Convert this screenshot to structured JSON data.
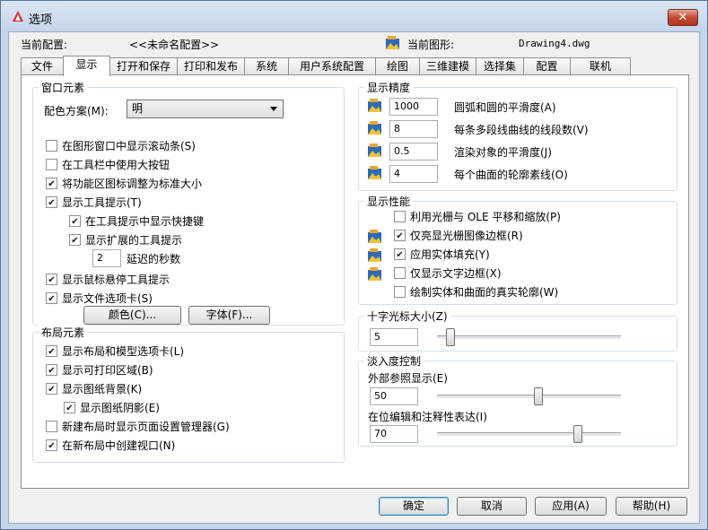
{
  "window": {
    "title": "选项",
    "close_label": "✕"
  },
  "profile": {
    "label": "当前配置:",
    "value": "<<未命名配置>>"
  },
  "drawing": {
    "label": "当前图形:",
    "value": "Drawing4.dwg"
  },
  "tabs": [
    "文件",
    "显示",
    "打开和保存",
    "打印和发布",
    "系统",
    "用户系统配置",
    "绘图",
    "三维建模",
    "选择集",
    "配置",
    "联机"
  ],
  "active_tab": "显示",
  "window_elements": {
    "title": "窗口元素",
    "color_scheme_label": "配色方案(M):",
    "color_scheme_value": "明",
    "items": [
      {
        "label": "在图形窗口中显示滚动条(S)",
        "checked": false
      },
      {
        "label": "在工具栏中使用大按钮",
        "checked": false
      },
      {
        "label": "将功能区图标调整为标准大小",
        "checked": true
      },
      {
        "label": "显示工具提示(T)",
        "checked": true
      },
      {
        "label": "在工具提示中显示快捷键",
        "checked": true
      },
      {
        "label": "显示扩展的工具提示",
        "checked": true
      },
      {
        "label": "显示鼠标悬停工具提示",
        "checked": true
      },
      {
        "label": "显示文件选项卡(S)",
        "checked": true
      }
    ],
    "delay_value": "2",
    "delay_label": "延迟的秒数",
    "colors_button": "颜色(C)...",
    "fonts_button": "字体(F)..."
  },
  "layout_elements": {
    "title": "布局元素",
    "items": [
      {
        "label": "显示布局和模型选项卡(L)",
        "checked": true
      },
      {
        "label": "显示可打印区域(B)",
        "checked": true
      },
      {
        "label": "显示图纸背景(K)",
        "checked": true
      },
      {
        "label": "显示图纸阴影(E)",
        "checked": true
      },
      {
        "label": "新建布局时显示页面设置管理器(G)",
        "checked": false
      },
      {
        "label": "在新布局中创建视口(N)",
        "checked": true
      }
    ]
  },
  "display_resolution": {
    "title": "显示精度",
    "items": [
      {
        "value": "1000",
        "label": "圆弧和圆的平滑度(A)"
      },
      {
        "value": "8",
        "label": "每条多段线曲线的线段数(V)"
      },
      {
        "value": "0.5",
        "label": "渲染对象的平滑度(J)"
      },
      {
        "value": "4",
        "label": "每个曲面的轮廓素线(O)"
      }
    ]
  },
  "display_performance": {
    "title": "显示性能",
    "items": [
      {
        "label": "利用光栅与 OLE 平移和缩放(P)",
        "checked": false
      },
      {
        "label": "仅亮显光栅图像边框(R)",
        "checked": true
      },
      {
        "label": "应用实体填充(Y)",
        "checked": true
      },
      {
        "label": "仅显示文字边框(X)",
        "checked": false
      },
      {
        "label": "绘制实体和曲面的真实轮廓(W)",
        "checked": false
      }
    ]
  },
  "crosshair": {
    "title": "十字光标大小(Z)",
    "value": "5",
    "level": 5
  },
  "fade": {
    "title": "淡入度控制",
    "xref_label": "外部参照显示(E)",
    "xref_value": "50",
    "xref_level": 50,
    "inplace_label": "在位编辑和注释性表达(I)",
    "inplace_value": "70",
    "inplace_level": 70
  },
  "buttons": {
    "ok": "确定",
    "cancel": "取消",
    "apply": "应用(A)",
    "help": "帮助(H)"
  }
}
